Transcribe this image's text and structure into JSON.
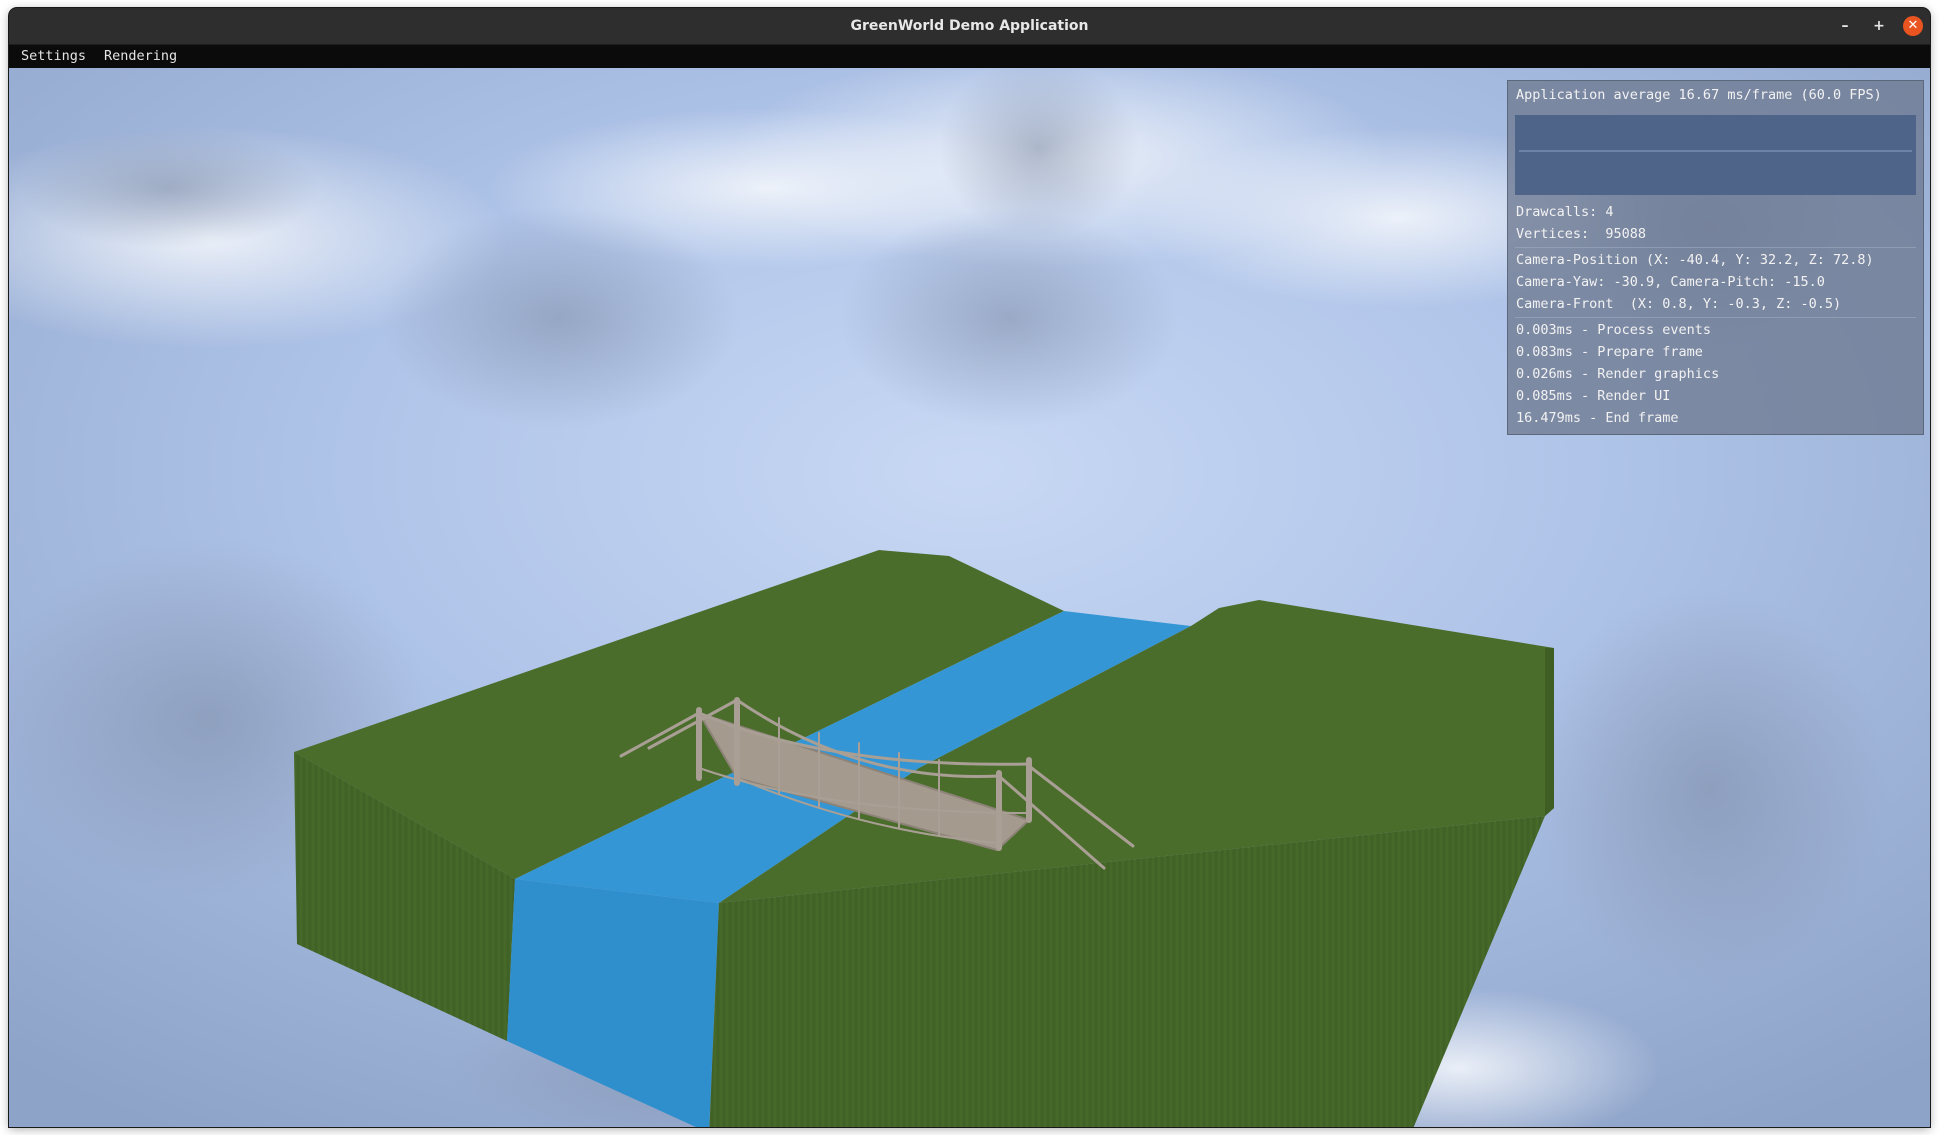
{
  "window": {
    "title": "GreenWorld Demo Application",
    "controls": {
      "minimize": "–",
      "maximize": "+",
      "close": "✕"
    }
  },
  "menubar": {
    "items": [
      "Settings",
      "Rendering"
    ]
  },
  "stats": {
    "fps_line": "Application average 16.67 ms/frame (60.0 FPS)",
    "drawcalls": "Drawcalls: 4",
    "vertices": "Vertices:  95088",
    "camera_position": "Camera-Position (X: -40.4, Y: 32.2, Z: 72.8)",
    "camera_yaw_pitch": "Camera-Yaw: -30.9, Camera-Pitch: -15.0",
    "camera_front": "Camera-Front  (X: 0.8, Y: -0.3, Z: -0.5)",
    "timings": [
      "0.003ms - Process events",
      "0.083ms - Prepare frame",
      "0.026ms - Render graphics",
      "0.085ms - Render UI",
      "16.479ms - End frame"
    ]
  },
  "colors": {
    "grass": "#46692a",
    "water": "#3195d3",
    "sky": "#a9bee6",
    "close_button": "#e95420"
  }
}
